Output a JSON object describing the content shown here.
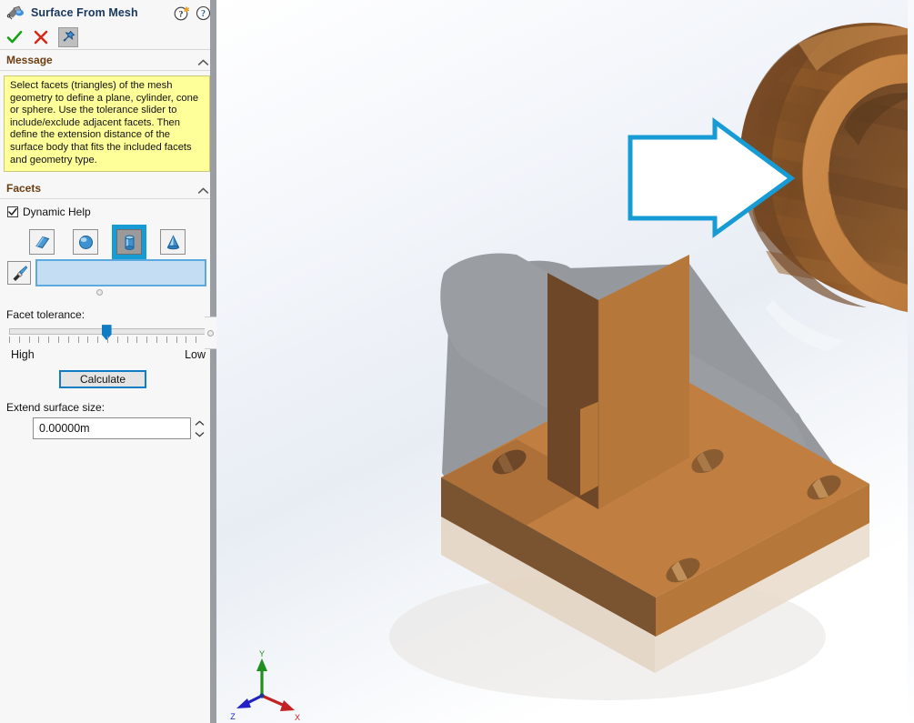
{
  "panel": {
    "title": "Surface From Mesh",
    "title_icon": "surface-from-mesh-icon",
    "help_icons": [
      {
        "name": "whats-new-help-icon",
        "glyph": "?"
      },
      {
        "name": "help-icon",
        "glyph": "?"
      }
    ],
    "actions": {
      "ok": {
        "name": "ok-button",
        "glyph": "✓",
        "color": "#1a9a1a"
      },
      "cancel": {
        "name": "cancel-button",
        "glyph": "✕",
        "color": "#d22b19"
      },
      "pin": {
        "name": "pin-button",
        "glyph": "pushpin",
        "pressed": true
      }
    },
    "sections": [
      {
        "id": "message",
        "header": "Message",
        "collapsed": false,
        "body": "Select facets (triangles) of the mesh geometry to define a plane, cylinder, cone or sphere.  Use the tolerance slider to include/exclude adjacent facets.  Then define the extension distance of the surface body that fits the included facets and geometry type.",
        "bg_color": "#ffff99"
      },
      {
        "id": "facets",
        "header": "Facets",
        "collapsed": false
      }
    ],
    "facets": {
      "dynamic_help": {
        "label": "Dynamic Help",
        "checked": true
      },
      "geometry_types": [
        {
          "name": "plane-geometry-button",
          "label": "Plane",
          "selected": false
        },
        {
          "name": "sphere-geometry-button",
          "label": "Sphere",
          "selected": false
        },
        {
          "name": "cylinder-geometry-button",
          "label": "Cylinder",
          "selected": true
        },
        {
          "name": "cone-geometry-button",
          "label": "Cone",
          "selected": false
        }
      ],
      "selection": {
        "brush_icon": "paintbrush-icon",
        "box_value": "",
        "box_placeholder": "",
        "box_fill": "#c5ddf2",
        "box_border": "#5ca9e0"
      },
      "tolerance": {
        "label": "Facet tolerance:",
        "high_label": "High",
        "low_label": "Low",
        "value_percent": 47,
        "tick_count": 21
      },
      "calculate_button": "Calculate",
      "extend": {
        "label": "Extend surface size:",
        "value": "0.00000m",
        "spinner_up": "∧",
        "spinner_down": "∨"
      }
    },
    "accent_color": "#169bd5",
    "header_text_color": "#6b3e10"
  },
  "viewport": {
    "name": "3d-model-viewport",
    "annotation": {
      "name": "callout-arrow",
      "shape": "right-arrow",
      "stroke": "#169bd5",
      "fill": "#ffffff"
    },
    "model": {
      "name": "mesh-bracket-model",
      "description": "Faceted mesh bracket with cylindrical boss and base plate",
      "colors": {
        "light": "#c6813f",
        "mid": "#b5773a",
        "dark": "#7a5430",
        "darker": "#6a4728",
        "bore": "#8a5c31",
        "shadow": "#95999d",
        "ground": "#dbc9b5"
      }
    },
    "triad": {
      "name": "coordinate-triad",
      "axes": [
        {
          "label": "X",
          "color": "#cc2222"
        },
        {
          "label": "Y",
          "color": "#22aa22"
        },
        {
          "label": "Z",
          "color": "#2222cc"
        }
      ]
    }
  }
}
